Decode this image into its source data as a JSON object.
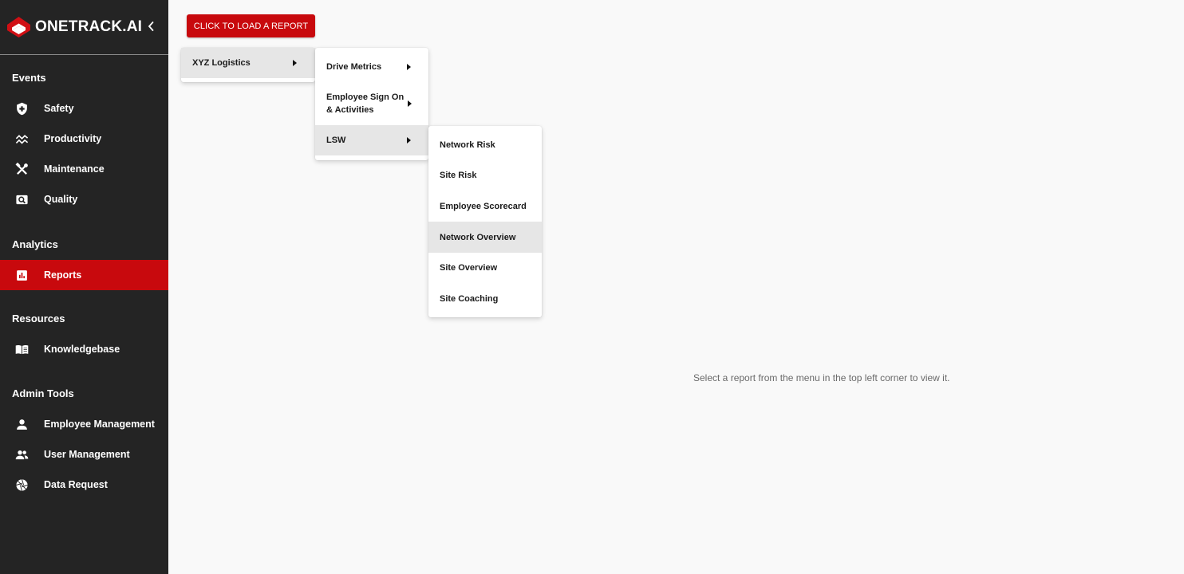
{
  "brand": {
    "name": "ONETRACK.AI"
  },
  "sidebar": {
    "sections": [
      {
        "title": "Events",
        "items": [
          {
            "label": "Safety",
            "icon": "shield-icon"
          },
          {
            "label": "Productivity",
            "icon": "trend-icon"
          },
          {
            "label": "Maintenance",
            "icon": "tools-icon"
          },
          {
            "label": "Quality",
            "icon": "quality-search-icon"
          }
        ]
      },
      {
        "title": "Analytics",
        "items": [
          {
            "label": "Reports",
            "icon": "bar-chart-icon",
            "active": true
          }
        ]
      },
      {
        "title": "Resources",
        "items": [
          {
            "label": "Knowledgebase",
            "icon": "book-icon"
          }
        ]
      },
      {
        "title": "Admin Tools",
        "items": [
          {
            "label": "Employee Management",
            "icon": "person-icon"
          },
          {
            "label": "User Management",
            "icon": "people-icon"
          },
          {
            "label": "Data Request",
            "icon": "aperture-icon"
          }
        ]
      }
    ]
  },
  "main": {
    "load_button_label": "CLICK TO LOAD A REPORT",
    "hint_text": "Select a report from the menu in the top left corner to view it."
  },
  "menus": {
    "level1": [
      {
        "label": "XYZ Logistics",
        "has_submenu": true,
        "highlighted": true
      }
    ],
    "level2": [
      {
        "label": "Drive Metrics",
        "has_submenu": true
      },
      {
        "label": "Employee Sign On",
        "label_line2": "& Activities",
        "has_submenu": true
      },
      {
        "label": "LSW",
        "has_submenu": true,
        "highlighted": true
      }
    ],
    "level3": [
      {
        "label": "Network Risk"
      },
      {
        "label": "Site Risk"
      },
      {
        "label": "Employee Scorecard"
      },
      {
        "label": "Network Overview",
        "highlighted": true
      },
      {
        "label": "Site Overview"
      },
      {
        "label": "Site Coaching"
      }
    ]
  },
  "colors": {
    "accent": "#c8090d",
    "sidebar_bg": "#242424",
    "page_bg": "#f9f9f9",
    "menu_highlight": "#e6e6e6"
  }
}
